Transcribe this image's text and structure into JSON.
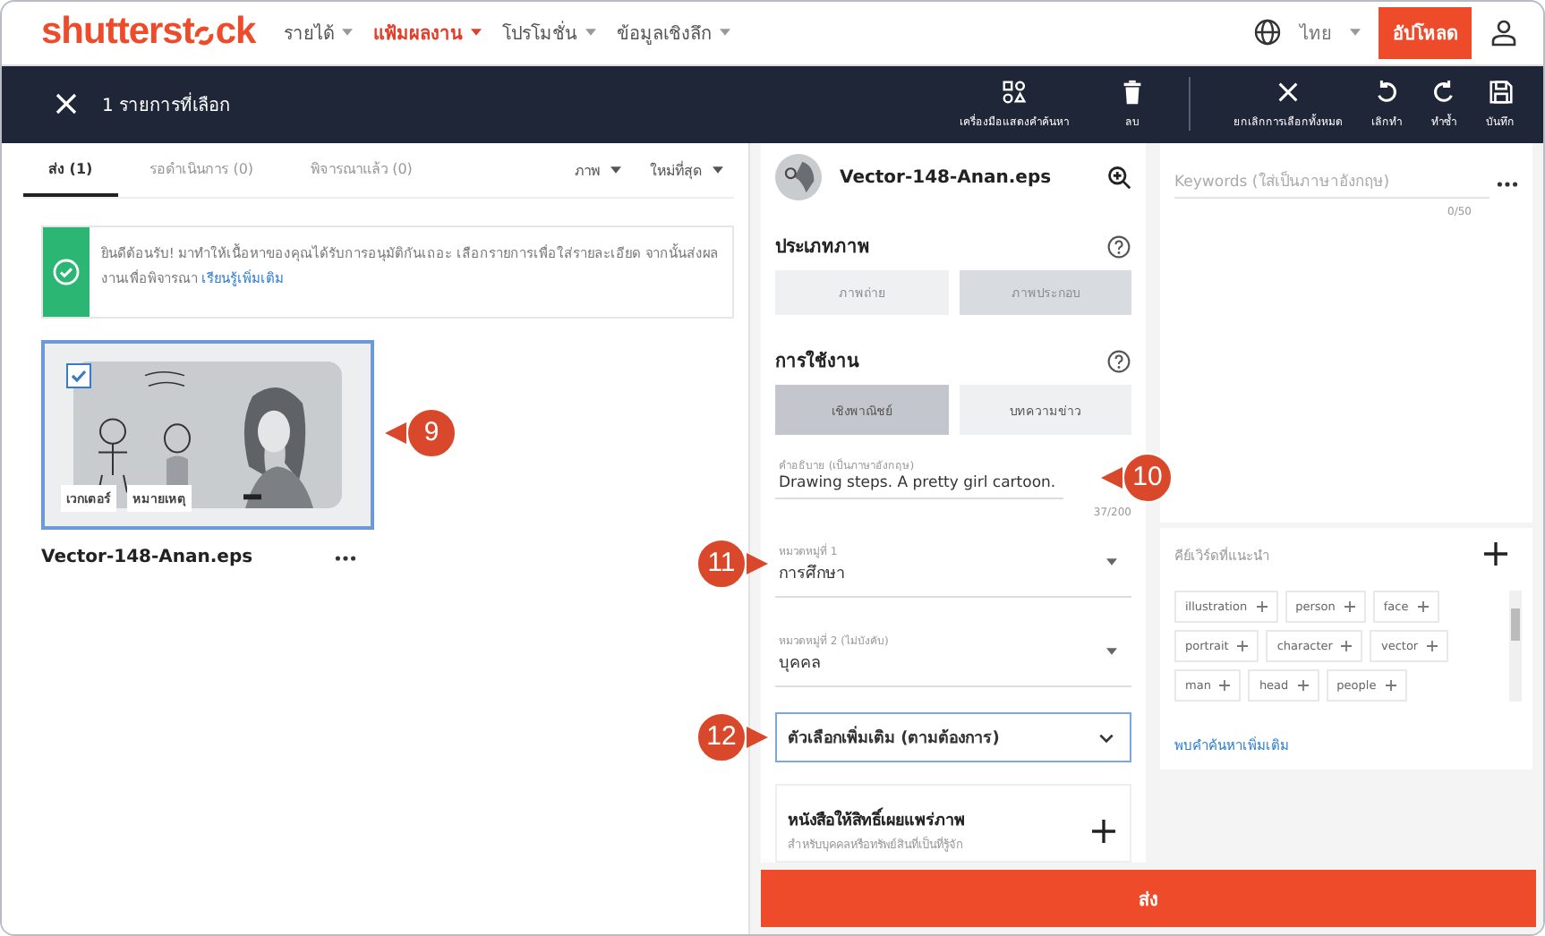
{
  "topnav": {
    "logo_a": "shutterst",
    "logo_b": "ck",
    "items": [
      {
        "label": "รายได้",
        "selected": false
      },
      {
        "label": "แฟ้มผลงาน",
        "selected": true
      },
      {
        "label": "โปรโมชั่น",
        "selected": false
      },
      {
        "label": "ข้อมูลเชิงลึก",
        "selected": false
      }
    ],
    "language": "ไทย",
    "upload": "อัปโหลด"
  },
  "selection_bar": {
    "count": "1 รายการที่เลือก",
    "actions": [
      {
        "kind": "keywords",
        "label": "เครื่องมือแสดงคำค้นหา"
      },
      {
        "kind": "delete",
        "label": "ลบ"
      },
      {
        "kind": "deselect",
        "label": "ยกเลิกการเลือกทั้งหมด"
      },
      {
        "kind": "undo",
        "label": "เลิกทำ"
      },
      {
        "kind": "redo",
        "label": "ทำซ้ำ"
      },
      {
        "kind": "save",
        "label": "บันทึก"
      }
    ]
  },
  "tabs": [
    {
      "label": "ส่ง (1)",
      "selected": true
    },
    {
      "label": "รอดำเนินการ (0)",
      "selected": false
    },
    {
      "label": "พิจารณาแล้ว (0)",
      "selected": false
    }
  ],
  "filters": [
    "ภาพ",
    "ใหม่ที่สุด"
  ],
  "banner": {
    "text": "ยินดีต้อนรับ! มาทำให้เนื้อหาของคุณได้รับการอนุมัติกันเถอะ เลือกรายการเพื่อใส่รายละเอียด จากนั้นส่งผลงานเพื่อพิจารณา",
    "link": "เรียนรู้เพิ่มเติม"
  },
  "asset": {
    "checked": true,
    "tags": [
      "เวกเตอร์",
      "หมายเหตุ"
    ],
    "filename": "Vector-148-Anan.eps",
    "callout": "9"
  },
  "editor": {
    "filename": "Vector-148-Anan.eps",
    "image_type": {
      "title": "ประเภทภาพ",
      "options": [
        {
          "label": "ภาพถ่าย",
          "selected": false
        },
        {
          "label": "ภาพประกอบ",
          "selected": true
        }
      ]
    },
    "usage": {
      "title": "การใช้งาน",
      "options": [
        {
          "label": "เชิงพาณิชย์",
          "selected": true
        },
        {
          "label": "บทความข่าว",
          "selected": false
        }
      ]
    },
    "description": {
      "label": "คำอธิบาย (เป็นภาษาอังกฤษ)",
      "value": "Drawing steps. A pretty girl cartoon.",
      "count": "37/200",
      "callout": "10"
    },
    "categories": [
      {
        "label": "หมวดหมู่ที่ 1",
        "value": "การศึกษา",
        "callout": "11"
      },
      {
        "label": "หมวดหมู่ที่ 2 (ไม่บังคับ)",
        "value": "บุคคล"
      }
    ],
    "more_options": {
      "label": "ตัวเลือกเพิ่มเติม (ตามต้องการ)",
      "callout": "12"
    },
    "release": {
      "title": "หนังสือให้สิทธิ์เผยแพร่ภาพ",
      "subtitle": "สำหรับบุคคลหรือทรัพย์สินที่เป็นที่รู้จัก"
    },
    "submit": "ส่ง"
  },
  "keywords": {
    "placeholder": "Keywords (ใส่เป็นภาษาอังกฤษ)",
    "count": "0/50"
  },
  "suggestions": {
    "title": "คีย์เวิร์ดที่แนะนำ",
    "chips": [
      "illustration",
      "person",
      "face",
      "portrait",
      "character",
      "vector",
      "man",
      "head",
      "people"
    ],
    "link": "พบคำค้นหาเพิ่มเติม"
  }
}
